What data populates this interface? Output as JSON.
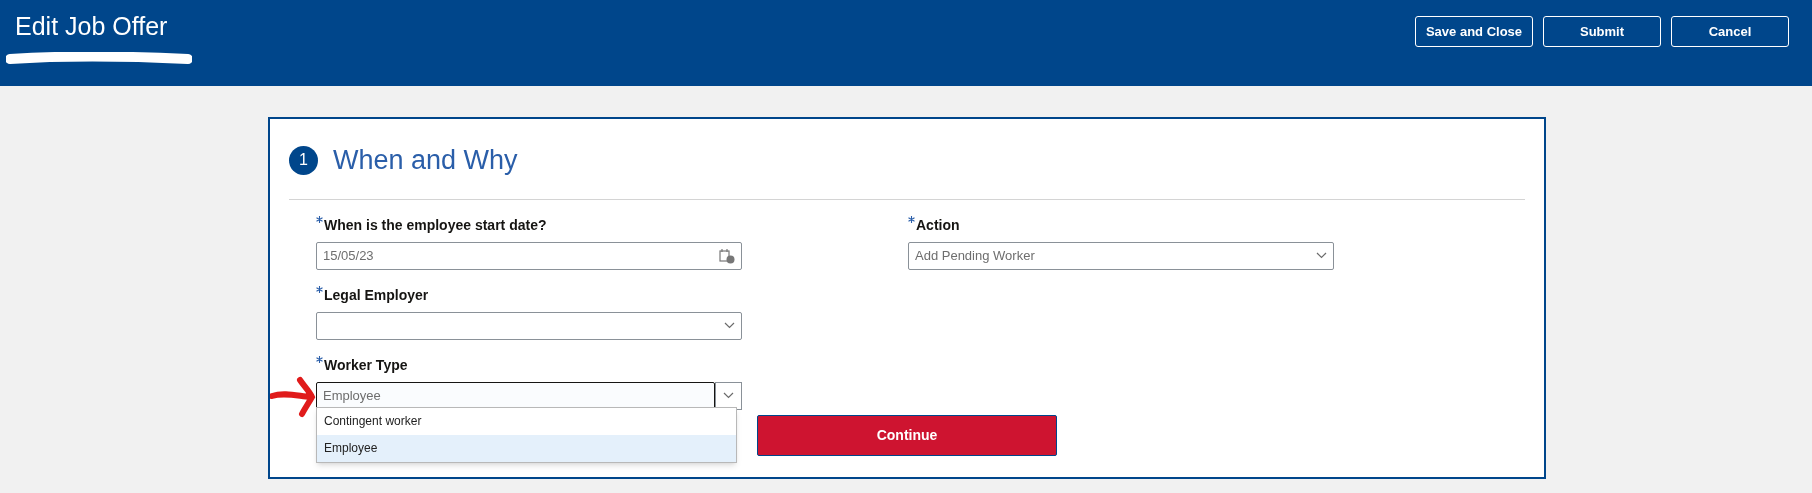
{
  "header": {
    "title": "Edit Job Offer",
    "actions": [
      "Save and Close",
      "Submit",
      "Cancel"
    ]
  },
  "section": {
    "number": "1",
    "title": "When and Why"
  },
  "fields": [
    {
      "label": "When is the employee start date?",
      "required": true,
      "kind": "date",
      "value": "15/05/23"
    },
    {
      "label": "Legal Employer",
      "required": true,
      "kind": "select"
    },
    {
      "label": "Worker Type",
      "required": true,
      "kind": "combo",
      "value": "Employee",
      "expanded": true,
      "options": [
        {
          "label": "Contingent worker",
          "selected": false
        },
        {
          "label": "Employee",
          "selected": true
        }
      ]
    }
  ],
  "right_fields": [
    {
      "label": "Action",
      "required": true,
      "kind": "select",
      "value": "Add Pending Worker"
    }
  ],
  "continue_button": "Continue"
}
